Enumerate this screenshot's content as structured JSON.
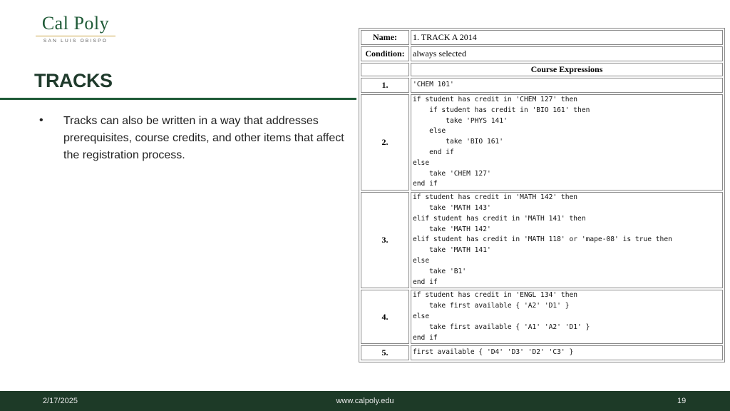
{
  "logo": {
    "main": "Cal Poly",
    "sub": "SAN LUIS OBISPO"
  },
  "slide": {
    "title": "TRACKS",
    "bullet": "Tracks can also be written in a way that addresses prerequisites, course credits, and other items that affect the registration process."
  },
  "table": {
    "name_label": "Name:",
    "name_value": "1. TRACK A 2014",
    "condition_label": "Condition:",
    "condition_value": "always selected",
    "header": "Course Expressions",
    "rows": [
      {
        "num": "1.",
        "code": "'CHEM 101'"
      },
      {
        "num": "2.",
        "code": "if student has credit in 'CHEM 127' then\n    if student has credit in 'BIO 161' then\n        take 'PHYS 141'\n    else\n        take 'BIO 161'\n    end if\nelse\n    take 'CHEM 127'\nend if"
      },
      {
        "num": "3.",
        "code": "if student has credit in 'MATH 142' then\n    take 'MATH 143'\nelif student has credit in 'MATH 141' then\n    take 'MATH 142'\nelif student has credit in 'MATH 118' or 'mape-08' is true then\n    take 'MATH 141'\nelse\n    take 'B1'\nend if"
      },
      {
        "num": "4.",
        "code": "if student has credit in 'ENGL 134' then\n    take first available { 'A2' 'D1' }\nelse\n    take first available { 'A1' 'A2' 'D1' }\nend if"
      },
      {
        "num": "5.",
        "code": "first available { 'D4' 'D3' 'D2' 'C3' }"
      }
    ]
  },
  "footer": {
    "date": "2/17/2025",
    "url": "www.calpoly.edu",
    "page": "19"
  },
  "colors": {
    "brand_green": "#1f5a37",
    "footer_bg": "#1d3a27",
    "gold": "#c9a23f"
  }
}
